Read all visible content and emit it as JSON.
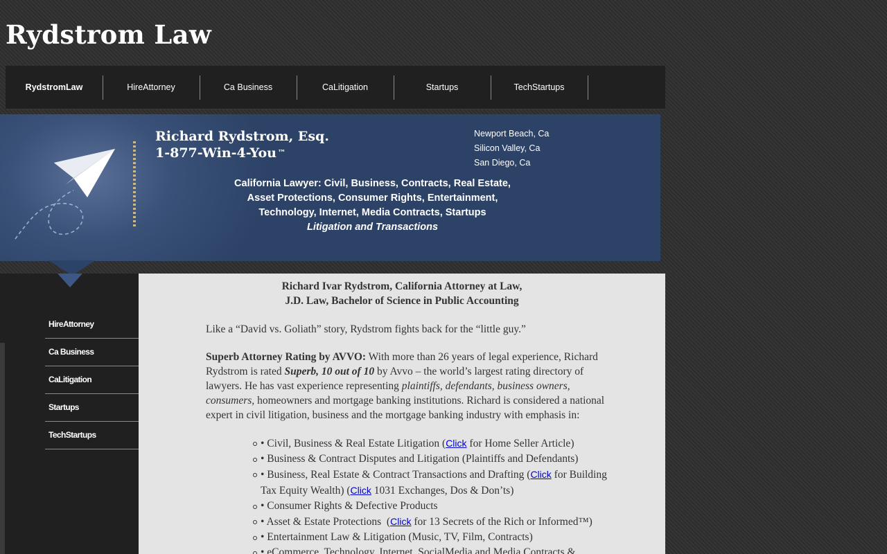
{
  "site": {
    "title": "Rydstrom Law"
  },
  "topnav": {
    "items": [
      "RydstromLaw",
      "HireAttorney",
      "Ca Business",
      "CaLitigation",
      "Startups",
      "TechStartups"
    ]
  },
  "banner": {
    "name": "Richard Rydstrom, Esq.",
    "phone": "1-877-Win-4-You",
    "phone_mark": "™",
    "locations": [
      "Newport Beach, Ca",
      "Silicon Valley, Ca",
      "San Diego, Ca"
    ],
    "practice_lines": [
      "California Lawyer: Civil, Business, Contracts, Real Estate,",
      "Asset Protections, Consumer Rights, Entertainment,",
      "Technology, Internet, Media Contracts, Startups"
    ],
    "tagline": "Litigation and Transactions"
  },
  "sidenav": {
    "items": [
      "HireAttorney",
      "Ca Business",
      "CaLitigation",
      "Startups",
      "TechStartups"
    ]
  },
  "content": {
    "heading_line1": "Richard Ivar Rydstrom, California Attorney at Law,",
    "heading_line2": "J.D. Law, Bachelor of Science in Public Accounting",
    "intro": "Like a “David vs. Goliath” story, Rydstrom fights back for the “little guy.”",
    "avvo": {
      "label": "Superb Attorney Rating by AVVO:",
      "text1": " With more than 26 years of legal experience, Richard Rydstrom is rated ",
      "rating": "Superb, 10 out of 10",
      "text2": " by Avvo – the world’s largest rating directory of lawyers. He has vast experience representing ",
      "clients": "plaintiffs, defendants, business owners, consumers,",
      "text3": " homeowners and mortgage banking institutions. Richard is considered a national expert in civil litigation, business and the mortgage banking industry with emphasis in:"
    },
    "list": {
      "item1_pre": "• Civil, Business & Real Estate Litigation (",
      "item1_link": "Click",
      "item1_post": " for Home Seller Article)",
      "item2": "• Business & Contract Disputes and Litigation (Plaintiffs and Defendants)",
      "item3_pre": "• Business, Real Estate & Contract Transactions and Drafting (",
      "item3_link1": "Click",
      "item3_mid": " for Building Tax Equity Wealth) (",
      "item3_link2": "Click",
      "item3_post": " 1031 Exchanges, Dos & Don’ts)",
      "item4": "• Consumer Rights & Defective Products",
      "item5_pre": "• Asset & Estate Protections  (",
      "item5_link": "Click",
      "item5_post": " for 13 Secrets of the Rich or Informed™)",
      "item6": "• Entertainment Law & Litigation (Music, TV, Film, Contracts)",
      "item7": "• eCommerce, Technology, Internet, SocialMedia and Media Contracts &"
    }
  }
}
